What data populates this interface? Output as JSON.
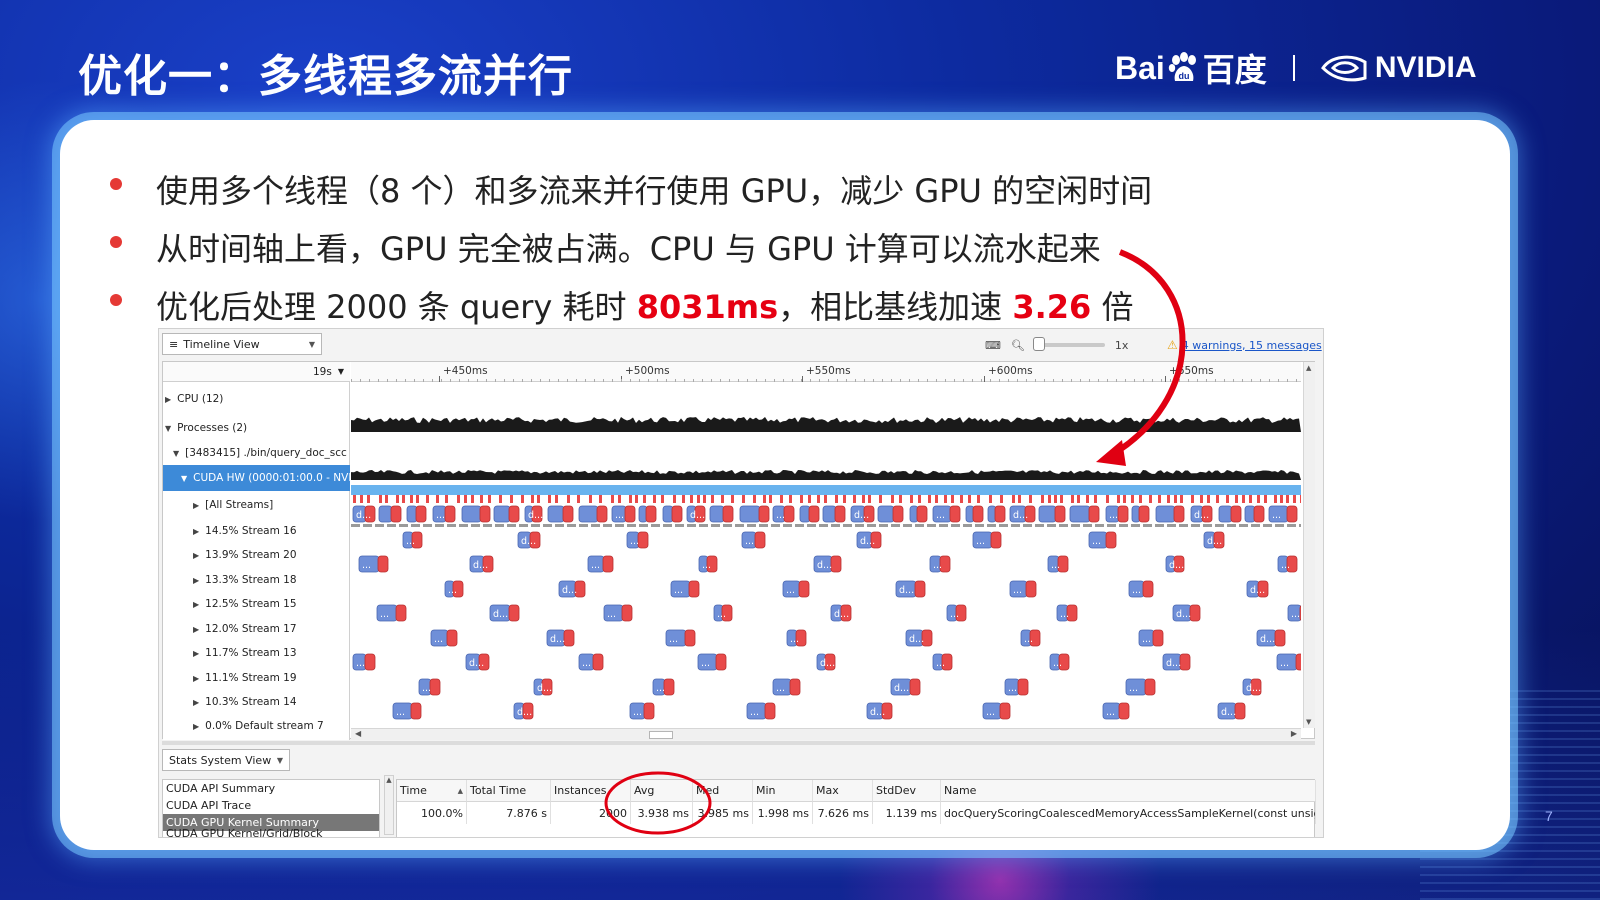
{
  "slide": {
    "title": "优化一：多线程多流并行",
    "page_number": "7",
    "logos": {
      "baidu_text_a": "Bai",
      "baidu_text_b": "百度",
      "nvidia_text": "NVIDIA"
    },
    "colors": {
      "accent_red": "#e60012",
      "bullet_dot": "#e53935",
      "bg_blue": "#0d2ba0"
    },
    "bullets": [
      {
        "text": "使用多个线程（8 个）和多流来并行使用 GPU，减少 GPU 的空闲时间"
      },
      {
        "text": "从时间轴上看，GPU 完全被占满。CPU 与 GPU 计算可以流水起来"
      },
      {
        "prefix": "优化后处理 2000 条 query 耗时 ",
        "highlight1": "8031ms",
        "middle": "，相比基线加速 ",
        "highlight2": "3.26",
        "suffix": " 倍"
      }
    ]
  },
  "nsight": {
    "view_selector": "Timeline View",
    "zoom_level": "1x",
    "warnings_link": "4 warnings, 15 messages",
    "time_scale": "19s",
    "ruler_ticks": [
      "+450ms",
      "+500ms",
      "+550ms",
      "+600ms",
      "+650ms"
    ],
    "tree_rows": [
      {
        "label": "CPU (12)",
        "expanded": false
      },
      {
        "label": "Processes (2)",
        "expanded": true
      },
      {
        "label": "[3483415] ./bin/query_doc_scc",
        "expanded": true
      },
      {
        "label": "CUDA HW (0000:01:00.0 - NVI",
        "expanded": true,
        "selected": true
      },
      {
        "label": "[All Streams]",
        "expanded": false
      },
      {
        "label": "14.5% Stream 16",
        "expanded": false
      },
      {
        "label": "13.9% Stream 20",
        "expanded": false
      },
      {
        "label": "13.3% Stream 18",
        "expanded": false
      },
      {
        "label": "12.5% Stream 15",
        "expanded": false
      },
      {
        "label": "12.0% Stream 17",
        "expanded": false
      },
      {
        "label": "11.7% Stream 13",
        "expanded": false
      },
      {
        "label": "11.1% Stream 19",
        "expanded": false
      },
      {
        "label": "10.3% Stream 14",
        "expanded": false
      },
      {
        "label": "0.0% Default stream 7",
        "expanded": false
      }
    ],
    "kernel_box_label_a": "d...",
    "kernel_box_label_b": "...",
    "stats_view_selector": "Stats System View",
    "stats_reports": [
      "CUDA API Summary",
      "CUDA API Trace",
      "CUDA GPU Kernel Summary",
      "CUDA GPU Kernel/Grid/Block Summary"
    ],
    "stats_selected_index": 2,
    "stats_table": {
      "headers": [
        "Time",
        "Total Time",
        "Instances",
        "Avg",
        "Med",
        "Min",
        "Max",
        "StdDev",
        "Name"
      ],
      "rows": [
        [
          "100.0%",
          "7.876 s",
          "2000",
          "3.938 ms",
          "3.985 ms",
          "1.998 ms",
          "7.626 ms",
          "1.139 ms",
          "docQueryScoringCoalescedMemoryAccessSampleKernel(const unsigr"
        ]
      ]
    },
    "colors": {
      "kernel_blue": "#6f8fd8",
      "kernel_red": "#e84a4a",
      "selection_blue": "#3d8ad8",
      "cuda_hw_bar": "#69b3ee"
    }
  }
}
